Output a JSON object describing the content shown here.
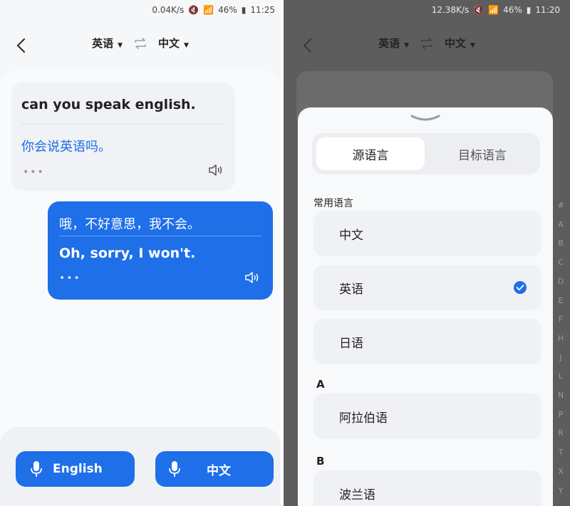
{
  "left": {
    "status": {
      "speed": "0.04K/s",
      "battery": "46%",
      "time": "11:25"
    },
    "header": {
      "source_lang": "英语",
      "target_lang": "中文"
    },
    "messages": [
      {
        "source": "can you speak english.",
        "translation": "你会说英语吗。",
        "more": "•••"
      },
      {
        "source": "哦，不好意思，我不会。",
        "translation": "Oh, sorry, I won't.",
        "more": "•••"
      }
    ],
    "buttons": {
      "english": "English",
      "chinese": "中文"
    }
  },
  "right": {
    "status": {
      "speed": "12.38K/s",
      "battery": "46%",
      "time": "11:20"
    },
    "header": {
      "source_lang": "英语",
      "target_lang": "中文"
    },
    "sheet": {
      "tabs": {
        "source": "源语言",
        "target": "目标语言"
      },
      "section_common": "常用语言",
      "common_languages": [
        "中文",
        "英语",
        "日语"
      ],
      "selected": "英语",
      "section_a": "A",
      "a_languages": [
        "阿拉伯语"
      ],
      "section_b": "B",
      "b_languages": [
        "波兰语"
      ],
      "index_letters": [
        "#",
        "A",
        "B",
        "C",
        "D",
        "E",
        "F",
        "H",
        "J",
        "L",
        "N",
        "P",
        "R",
        "T",
        "X",
        "Y",
        "Z"
      ]
    }
  },
  "colors": {
    "accent": "#1e6fe8",
    "overlay": "#5d5d5d"
  }
}
